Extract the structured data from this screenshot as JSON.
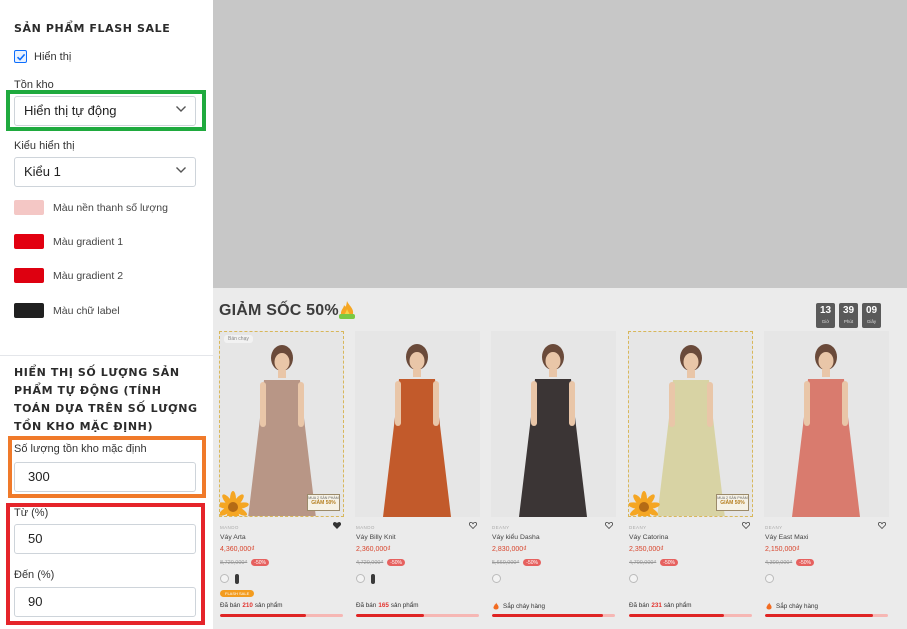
{
  "panel": {
    "section1_title": "SẢN PHẨM FLASH SALE",
    "show_checkbox_label": "Hiển thị",
    "show_checked": true,
    "stock_label": "Tồn kho",
    "stock_value": "Hiển thị tự động",
    "display_style_label": "Kiểu hiển thị",
    "display_style_value": "Kiểu 1",
    "colors": [
      {
        "label": "Màu nền thanh số lượng",
        "color": "#f4c7c5"
      },
      {
        "label": "Màu gradient 1",
        "color": "#e20010"
      },
      {
        "label": "Màu gradient 2",
        "color": "#de0010"
      },
      {
        "label": "Màu chữ label",
        "color": "#202020"
      }
    ],
    "section2_title": "HIỂN THỊ SỐ LƯỢNG SẢN PHẨM TỰ ĐỘNG (TÍNH TOÁN DỰA TRÊN SỐ LƯỢNG TỒN KHO MẶC ĐỊNH)",
    "default_stock_label": "Số lượng tồn kho mặc định",
    "default_stock_value": "300",
    "from_label": "Từ (%)",
    "from_value": "50",
    "to_label": "Đến (%)",
    "to_value": "90"
  },
  "highlight_colors": {
    "green": "#1faa3e",
    "orange": "#f07a2a",
    "red": "#e5242a"
  },
  "preview": {
    "title": "GIẢM SỐC 50%",
    "countdown": [
      {
        "value": "13",
        "unit": "Giờ"
      },
      {
        "value": "39",
        "unit": "Phút"
      },
      {
        "value": "09",
        "unit": "Giây"
      }
    ],
    "products": [
      {
        "brand": "MANDO",
        "name": "Váy Arta",
        "price": "4,360,000₫",
        "original": "8,720,000₫",
        "discount": "-50%",
        "badge": "Bán chạy",
        "promo_small": "MUA 2 SẢN PHẨM",
        "promo_big": "GIẢM 50%",
        "flash_tag": "FLASH SALE",
        "sold_prefix": "Đã bán",
        "sold_count": "210",
        "sold_suffix": "sản phẩm",
        "progress": 0.7,
        "dress": "#b89686"
      },
      {
        "brand": "MANDO",
        "name": "Váy Billy Knit",
        "price": "2,360,000₫",
        "original": "4,720,000₫",
        "discount": "-50%",
        "badge": "",
        "promo_small": "",
        "promo_big": "",
        "flash_tag": "",
        "sold_prefix": "Đã bán",
        "sold_count": "165",
        "sold_suffix": "sản phẩm",
        "progress": 0.55,
        "dress": "#c25a2b"
      },
      {
        "brand": "DEANY",
        "name": "Váy kiểu Dasha",
        "price": "2,830,000₫",
        "original": "5,660,000₫",
        "discount": "-50%",
        "badge": "",
        "promo_small": "",
        "promo_big": "",
        "flash_tag": "",
        "sold_prefix": "",
        "sold_count": "",
        "sold_suffix": "Sắp cháy hàng",
        "progress": 0.9,
        "dress": "#3b3535"
      },
      {
        "brand": "DEANY",
        "name": "Váy Catorina",
        "price": "2,350,000₫",
        "original": "4,700,000₫",
        "discount": "-50%",
        "badge": "",
        "promo_small": "MUA 2 SẢN PHẨM",
        "promo_big": "GIẢM 50%",
        "flash_tag": "",
        "sold_prefix": "Đã bán",
        "sold_count": "231",
        "sold_suffix": "sản phẩm",
        "progress": 0.77,
        "dress": "#d8d3a4"
      },
      {
        "brand": "DEANY",
        "name": "Váy East Maxi",
        "price": "2,150,000₫",
        "original": "4,300,000₫",
        "discount": "-50%",
        "badge": "",
        "promo_small": "",
        "promo_big": "",
        "flash_tag": "",
        "sold_prefix": "",
        "sold_count": "",
        "sold_suffix": "Sắp cháy hàng",
        "progress": 0.88,
        "dress": "#d97b6e"
      }
    ]
  }
}
